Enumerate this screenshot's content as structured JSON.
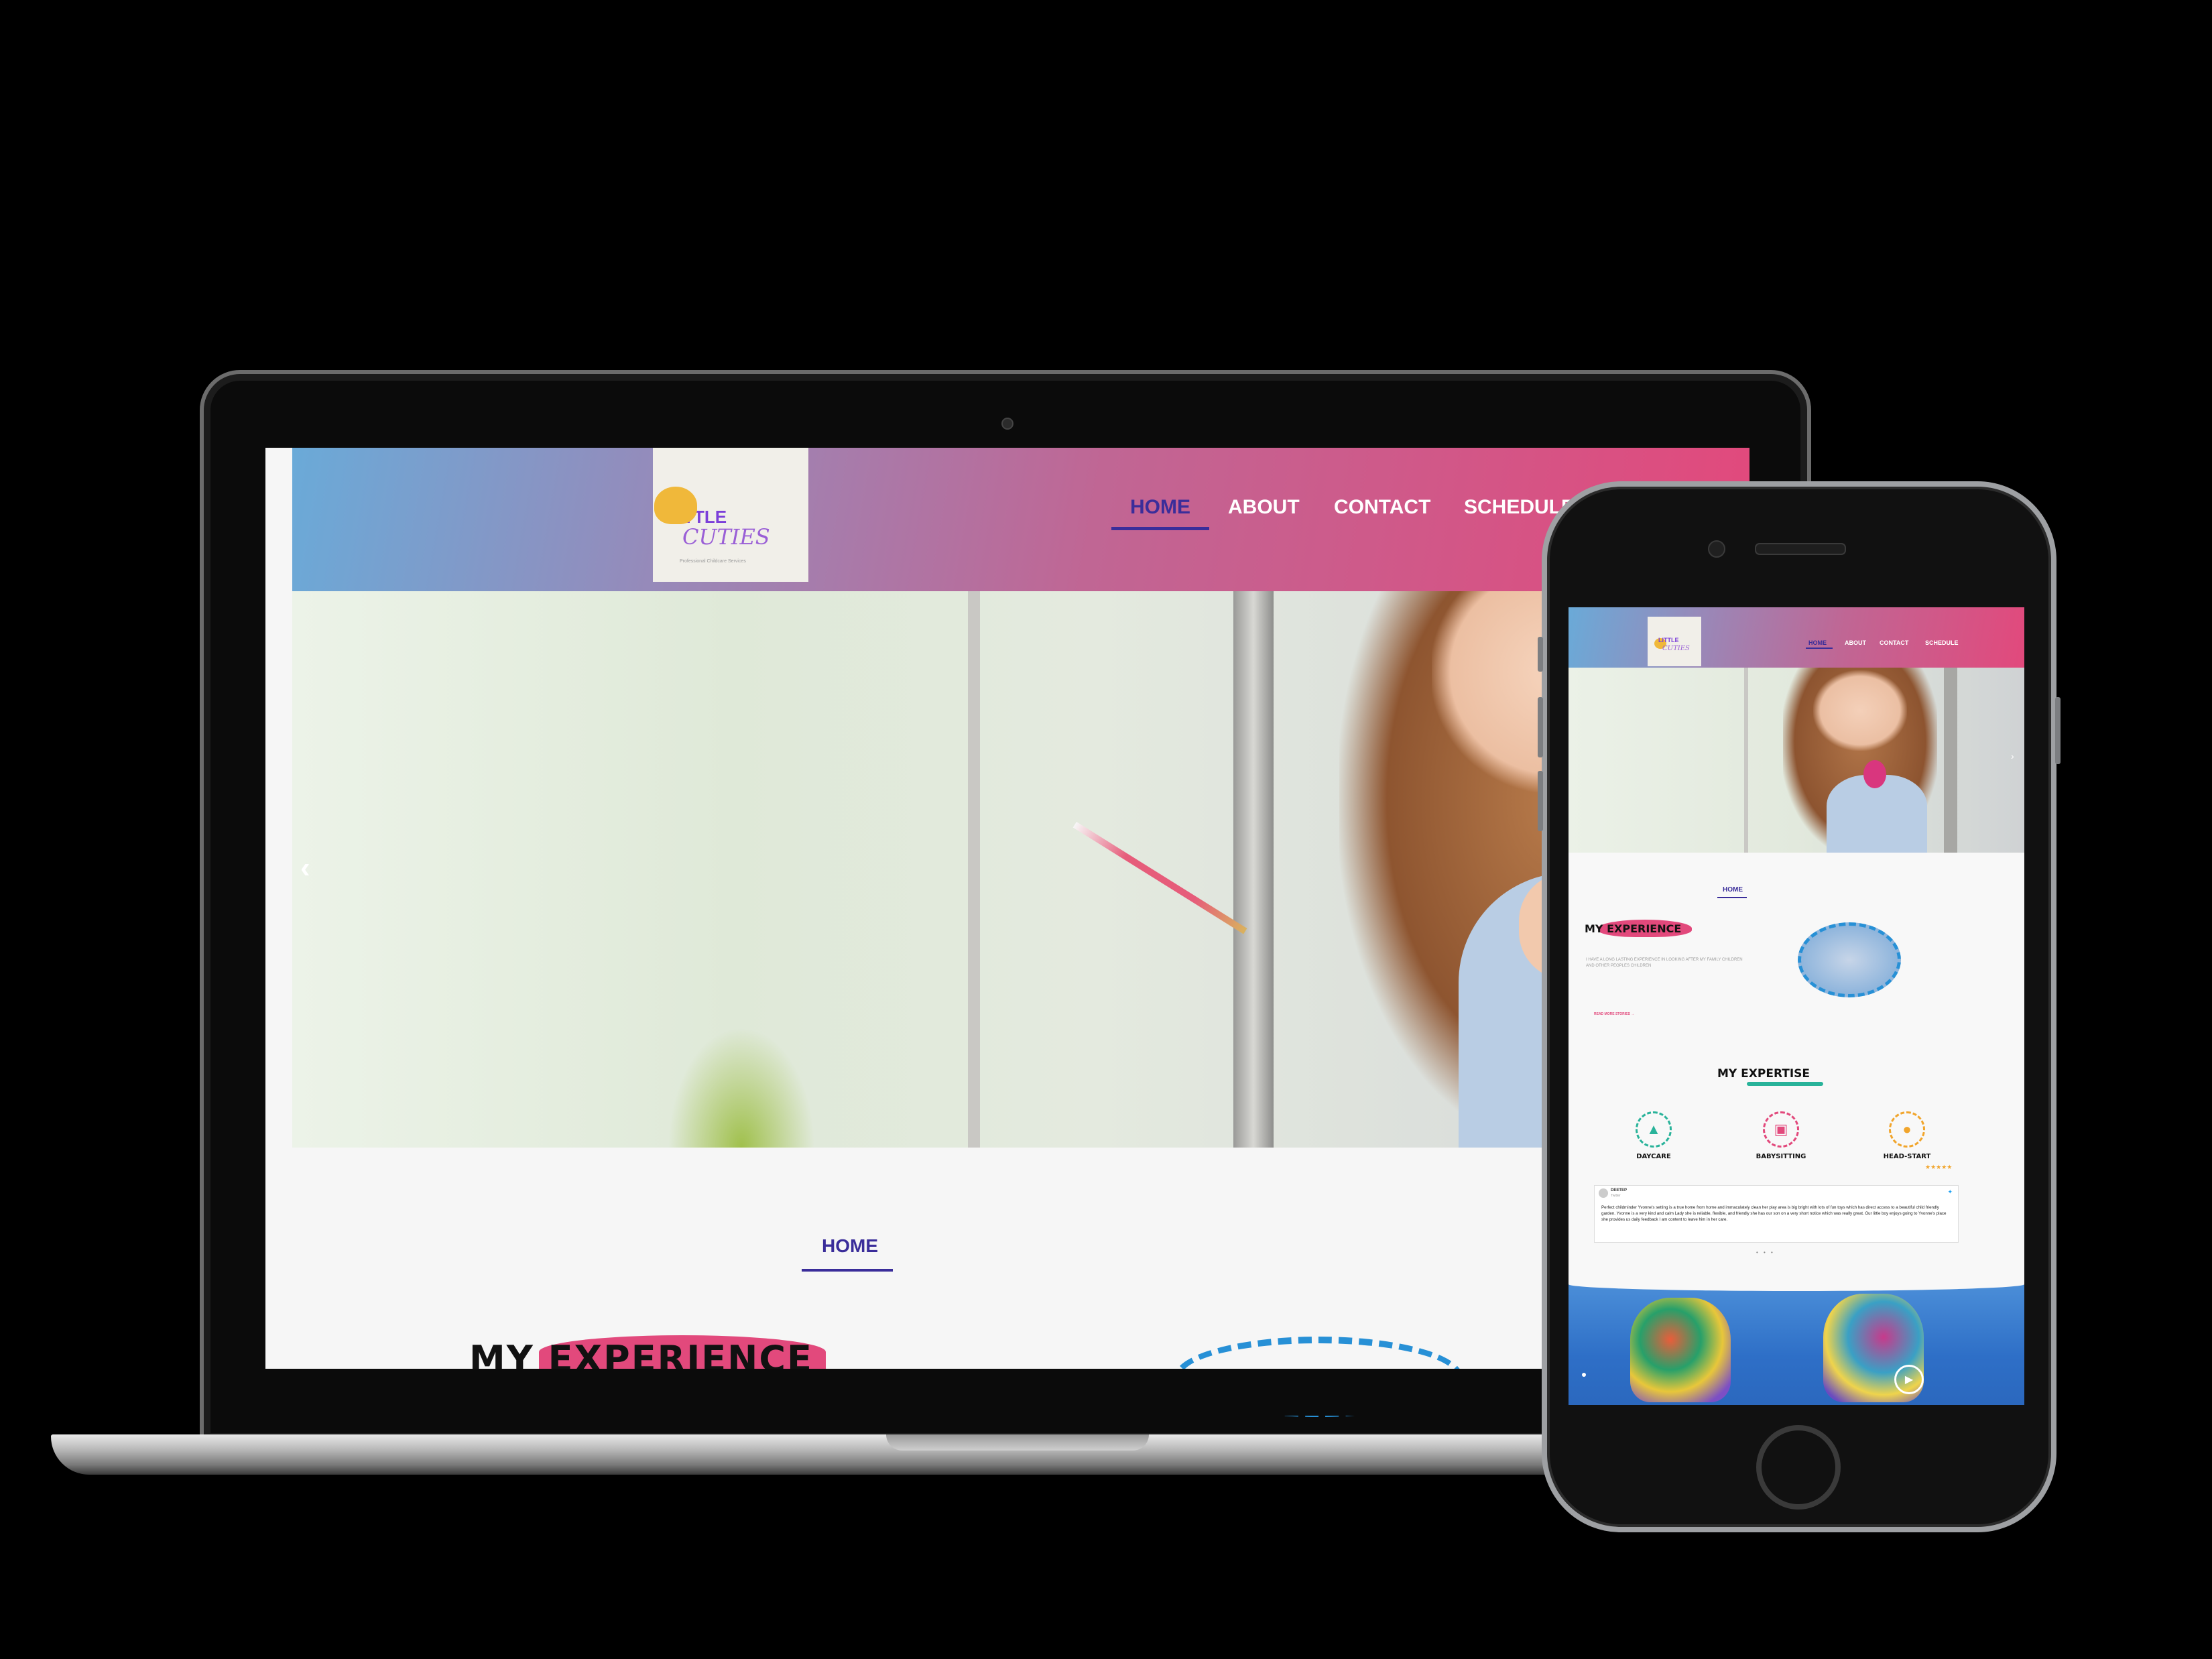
{
  "site": {
    "logo_line1": "LITTLE",
    "logo_line2": "CUTIES",
    "logo_tagline": "Professional Childcare Services",
    "nav": [
      "HOME",
      "ABOUT",
      "CONTACT",
      "SCHEDULE"
    ],
    "active_nav": "HOME",
    "section_label": "HOME",
    "experience_title": "MY EXPERIENCE",
    "experience_text": "I HAVE A LONG LASTING EXPERIENCE IN LOOKING AFTER MY FAMILY CHILDREN AND OTHER PEOPLES CHILDREN",
    "experience_link": "READ MORE STORIES →",
    "expertise_title": "MY EXPERTISE",
    "services": [
      "DAYCARE",
      "BABYSITTING",
      "HEAD-START"
    ],
    "service_icons": [
      "mountain-icon",
      "gift-icon",
      "backpack-icon"
    ],
    "rating_stars": "★★★★★",
    "review_author": "DEETEP",
    "review_source": "Twitter",
    "review_text": "Perfect childminder Yvonne's setting is a true home from home and immaculately clean her play area is big bright with lots of fun toys which has direct access to a beautiful child friendly garden. Yvonne is a very kind and calm Lady she is reliable, flexible, and friendly she has our son on a very short notice which was really great. Our little boy enjoys going to Yvonne's place she provides us daily feedback I am content to leave him in her care.",
    "carousel_dots": "• • •",
    "prev_arrow": "‹",
    "next_arrow": "›",
    "play_icon": "▶"
  },
  "colors": {
    "header_start": "#6aaad8",
    "header_end": "#e2497c",
    "active_nav": "#3a2d9a",
    "accent_pink": "#e2497c",
    "accent_blue": "#2790d6",
    "accent_teal": "#29b39a"
  }
}
